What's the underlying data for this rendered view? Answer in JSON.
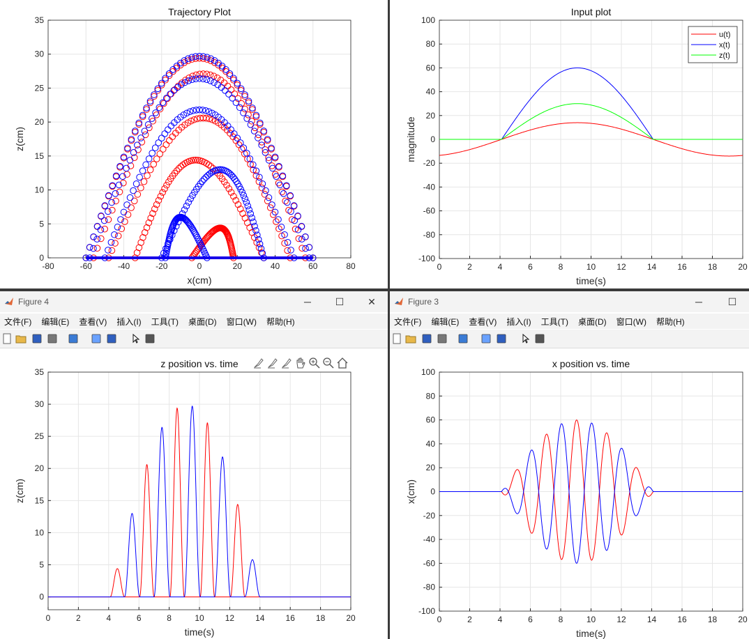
{
  "windows": {
    "fig4": {
      "title": "Figure 4"
    },
    "fig3": {
      "title": "Figure 3"
    }
  },
  "menu": [
    "文件(F)",
    "编辑(E)",
    "查看(V)",
    "插入(I)",
    "工具(T)",
    "桌面(D)",
    "窗口(W)",
    "帮助(H)"
  ],
  "toolbar_icons": [
    "new-figure-icon",
    "open-icon",
    "save-icon",
    "print-icon",
    "link-icon",
    "colorbar-icon",
    "legend-icon",
    "pointer-icon",
    "property-inspector-icon"
  ],
  "axes_toolbar_icons": [
    "brush-icon",
    "data-tip-icon",
    "select-icon",
    "pan-icon",
    "zoom-in-icon",
    "zoom-out-icon",
    "home-icon"
  ],
  "chart_data": [
    {
      "id": "trajectory",
      "type": "scatter",
      "title": "Trajectory Plot",
      "xlabel": "x(cm)",
      "ylabel": "z(cm)",
      "xlim": [
        -80,
        80
      ],
      "ylim": [
        0,
        35
      ],
      "xticks": [
        -80,
        -60,
        -40,
        -20,
        0,
        20,
        40,
        60,
        80
      ],
      "yticks": [
        0,
        5,
        10,
        15,
        20,
        25,
        30,
        35
      ],
      "grid": true,
      "marker": "circle",
      "series": [
        {
          "color": "#ff0000",
          "arcs": [
            {
              "x_start": -60,
              "x_end": 60,
              "peak_x": 0,
              "peak_z": 29.4
            },
            {
              "x_start": -56,
              "x_end": 56,
              "peak_x": 2,
              "peak_z": 27.1
            },
            {
              "x_start": -48,
              "x_end": 48,
              "peak_x": 2,
              "peak_z": 20.6
            },
            {
              "x_start": -34,
              "x_end": 34,
              "peak_x": -2,
              "peak_z": 14.4
            },
            {
              "x_start": -4,
              "x_end": 18,
              "peak_x": 4,
              "peak_z": 4.4
            }
          ]
        },
        {
          "color": "#0000ff",
          "arcs": [
            {
              "x_start": -60,
              "x_end": 60,
              "peak_x": 0,
              "peak_z": 29.7
            },
            {
              "x_start": -58,
              "x_end": 58,
              "peak_x": 0,
              "peak_z": 26.4
            },
            {
              "x_start": -50,
              "x_end": 50,
              "peak_x": 0,
              "peak_z": 21.8
            },
            {
              "x_start": -20,
              "x_end": 34,
              "peak_x": 4,
              "peak_z": 13.0
            },
            {
              "x_start": -18,
              "x_end": 4,
              "peak_x": -3,
              "peak_z": 6.0
            }
          ]
        }
      ]
    },
    {
      "id": "input",
      "type": "line",
      "title": "Input plot",
      "xlabel": "time(s)",
      "ylabel": "magnitude",
      "xlim": [
        0,
        20
      ],
      "ylim": [
        -100,
        100
      ],
      "xticks": [
        0,
        2,
        4,
        6,
        8,
        10,
        12,
        14,
        16,
        18,
        20
      ],
      "yticks": [
        -100,
        -80,
        -60,
        -40,
        -20,
        0,
        20,
        40,
        60,
        80,
        100
      ],
      "grid": true,
      "legend_position": "top-right",
      "series": [
        {
          "name": "u(t)",
          "color": "#ff0000",
          "shape": "cosine",
          "amplitude": 14,
          "period": 20,
          "peak_t": 9.1
        },
        {
          "name": "x(t)",
          "color": "#0000ff",
          "shape": "hump",
          "t_start": 4.1,
          "t_end": 14.1,
          "peak": 60
        },
        {
          "name": "z(t)",
          "color": "#00ff00",
          "shape": "hump",
          "t_start": 4.1,
          "t_end": 14.1,
          "peak": 30
        }
      ]
    },
    {
      "id": "zpos",
      "type": "line",
      "title": "z position vs. time",
      "xlabel": "time(s)",
      "ylabel": "z(cm)",
      "xlim": [
        0,
        20
      ],
      "ylim": [
        -2,
        35
      ],
      "xticks": [
        0,
        2,
        4,
        6,
        8,
        10,
        12,
        14,
        16,
        18,
        20
      ],
      "yticks": [
        0,
        5,
        10,
        15,
        20,
        25,
        30,
        35
      ],
      "grid": true,
      "series": [
        {
          "color": "#ff0000",
          "pulses": [
            {
              "t0": 4.1,
              "t1": 5.05,
              "peak": 4.4
            },
            {
              "t0": 6.05,
              "t1": 7.0,
              "peak": 20.6
            },
            {
              "t0": 8.05,
              "t1": 9.0,
              "peak": 29.4
            },
            {
              "t0": 10.05,
              "t1": 11.0,
              "peak": 27.1
            },
            {
              "t0": 12.05,
              "t1": 13.0,
              "peak": 14.4
            }
          ]
        },
        {
          "color": "#0000ff",
          "pulses": [
            {
              "t0": 5.05,
              "t1": 6.05,
              "peak": 13.0
            },
            {
              "t0": 7.0,
              "t1": 8.05,
              "peak": 26.4
            },
            {
              "t0": 9.0,
              "t1": 10.05,
              "peak": 29.7
            },
            {
              "t0": 11.0,
              "t1": 12.05,
              "peak": 21.8
            },
            {
              "t0": 13.0,
              "t1": 14.0,
              "peak": 5.8
            }
          ]
        }
      ]
    },
    {
      "id": "xpos",
      "type": "line",
      "title": "x position vs. time",
      "xlabel": "time(s)",
      "ylabel": "x(cm)",
      "xlim": [
        0,
        20
      ],
      "ylim": [
        -100,
        100
      ],
      "xticks": [
        0,
        2,
        4,
        6,
        8,
        10,
        12,
        14,
        16,
        18,
        20
      ],
      "yticks": [
        -100,
        -80,
        -60,
        -40,
        -20,
        0,
        20,
        40,
        60,
        80,
        100
      ],
      "grid": true,
      "envelope": {
        "t_start": 4.1,
        "t_end": 14.1,
        "peak": 60,
        "period_s": 2
      },
      "series": [
        {
          "color": "#ff0000",
          "sign": 1
        },
        {
          "color": "#0000ff",
          "sign": -1
        }
      ]
    }
  ]
}
